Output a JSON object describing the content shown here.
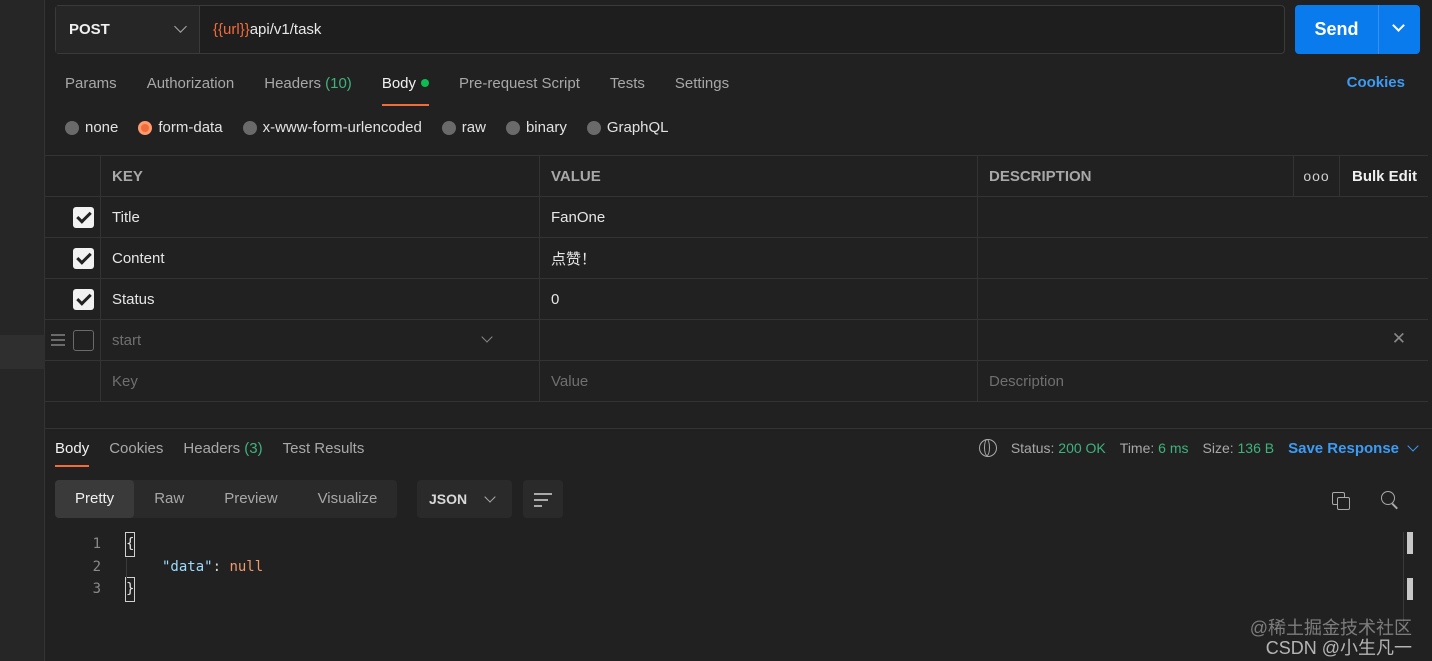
{
  "request": {
    "method": "POST",
    "url_var": "{{url}}",
    "url_path": "api/v1/task",
    "send_label": "Send"
  },
  "req_tabs": [
    {
      "label": "Params"
    },
    {
      "label": "Authorization"
    },
    {
      "label": "Headers",
      "count": "(10)"
    },
    {
      "label": "Body"
    },
    {
      "label": "Pre-request Script"
    },
    {
      "label": "Tests"
    },
    {
      "label": "Settings"
    }
  ],
  "cookies_label": "Cookies",
  "body_types": [
    "none",
    "form-data",
    "x-www-form-urlencoded",
    "raw",
    "binary",
    "GraphQL"
  ],
  "table": {
    "headers": {
      "key": "KEY",
      "value": "VALUE",
      "description": "DESCRIPTION",
      "more": "ooo",
      "bulk_edit": "Bulk Edit"
    },
    "rows": [
      {
        "key": "Title",
        "value": "FanOne",
        "checked": true
      },
      {
        "key": "Content",
        "value": "点赞！",
        "checked": true
      },
      {
        "key": "Status",
        "value": "0",
        "checked": true
      }
    ],
    "draft_row": {
      "key": "start"
    },
    "placeholders": {
      "key": "Key",
      "value": "Value",
      "description": "Description"
    }
  },
  "response": {
    "tabs": [
      {
        "label": "Body"
      },
      {
        "label": "Cookies"
      },
      {
        "label": "Headers",
        "count": "(3)"
      },
      {
        "label": "Test Results"
      }
    ],
    "status_label": "Status:",
    "status_value": "200 OK",
    "time_label": "Time:",
    "time_value": "6 ms",
    "size_label": "Size:",
    "size_value": "136 B",
    "save_label": "Save Response",
    "views": [
      "Pretty",
      "Raw",
      "Preview",
      "Visualize"
    ],
    "format": "JSON",
    "code": {
      "line1": "1",
      "line2": "2",
      "line3": "3",
      "open": "{",
      "key": "\"data\"",
      "colon": ": ",
      "val": "null",
      "close": "}"
    }
  },
  "watermark": {
    "line1": "@稀土掘金技术社区",
    "line2": "CSDN @小生凡一"
  },
  "colors": {
    "accent": "#f26b3a",
    "send": "#097bed",
    "link": "#3c9bf5",
    "ok": "#3fb27f"
  }
}
